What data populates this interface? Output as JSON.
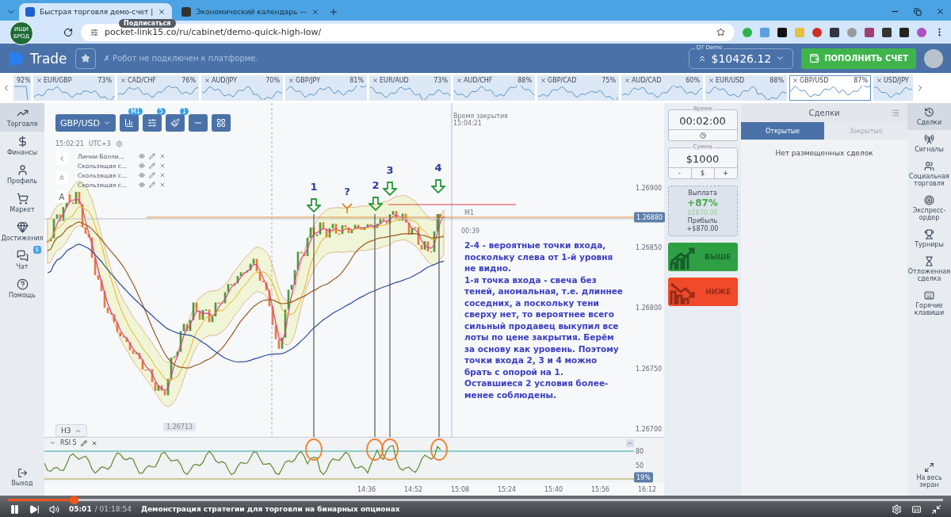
{
  "browser": {
    "tabs": [
      {
        "title": "Быстрая торговля демо-счет |",
        "selected": true
      },
      {
        "title": "Экономический календарь —",
        "selected": false
      }
    ],
    "url": "pocket-link15.co/ru/cabinet/demo-quick-high-low/"
  },
  "channel_overlay": {
    "avatar_text": "ИЩИ БРОД",
    "subscribe_tooltip": "Подписаться"
  },
  "header": {
    "logo": "Trade",
    "robot_status": "✗ Робот не подключен к платформе.",
    "account_label": "QT Demo",
    "balance": "$10426.12",
    "deposit_button": "ПОПОЛНИТЬ СЧЕТ"
  },
  "assets": [
    {
      "percent": "92%",
      "selected": false
    },
    {
      "name": "EUR/GBP",
      "percent": "73%",
      "selected": false
    },
    {
      "name": "CAD/CHF",
      "percent": "76%",
      "selected": false
    },
    {
      "name": "AUD/JPY",
      "percent": "70%",
      "selected": false
    },
    {
      "name": "GBP/JPY",
      "percent": "81%",
      "selected": false
    },
    {
      "name": "EUR/AUD",
      "percent": "73%",
      "selected": false
    },
    {
      "name": "AUD/CHF",
      "percent": "88%",
      "selected": false
    },
    {
      "name": "GBP/CAD",
      "percent": "75%",
      "selected": false
    },
    {
      "name": "AUD/CAD",
      "percent": "60%",
      "selected": false
    },
    {
      "name": "EUR/USD",
      "percent": "88%",
      "selected": false
    },
    {
      "name": "GBP/USD",
      "percent": "87%",
      "selected": true
    },
    {
      "name": "USD/JPY",
      "selected": false
    }
  ],
  "left_sidebar": {
    "items": [
      {
        "label": "Торговля",
        "selected": true
      },
      {
        "label": "Финансы",
        "selected": false
      },
      {
        "label": "Профиль",
        "selected": false
      },
      {
        "label": "Маркет",
        "selected": false
      },
      {
        "label": "Достижения",
        "selected": false
      },
      {
        "label": "Чат",
        "selected": false,
        "badge": "5"
      },
      {
        "label": "Помощь",
        "selected": false
      }
    ],
    "exit": "Выход"
  },
  "chart": {
    "pair": "GBP/USD",
    "toolbar_badges": [
      "M1",
      "5",
      "1"
    ],
    "clock": "15:02:21",
    "timezone": "UTC+3",
    "indicators": [
      "Линии Болли...",
      "Скользящая с...",
      "Скользящая с...",
      "Скользящая с..."
    ],
    "text_tool": "A",
    "closing_time_label": "Время закрытия",
    "closing_time": "15:04:21",
    "price_labels": [
      "1.26900",
      "1.26850",
      "1.26800",
      "1.26750",
      "1.26700"
    ],
    "current_price": "1.26880",
    "timeframe": "M1",
    "countdown": "00:39",
    "min_price": "1.26713",
    "zoom_button": "H3",
    "annotations": [
      {
        "label": "1",
        "kind": "arrow"
      },
      {
        "label": "?",
        "kind": "fork"
      },
      {
        "label": "2",
        "kind": "arrow"
      },
      {
        "label": "3",
        "kind": "arrow"
      },
      {
        "label": "4",
        "kind": "arrow"
      }
    ],
    "note": [
      "2-4 - вероятные точки входа, поскольку слева от 1-й уровня не видно.",
      "1-я точка входа - свеча без теней, аномальная, т.е. длиннее соседних, а поскольку тени сверху нет, то вероятнее всего сильный продавец выкупил все лоты по цене закрытия. Берём за основу как уровень. Поэтому точки входа 2, 3 и 4 можно брать с опорой на 1.",
      "Оставшиеся 2 условия более-менее соблюдены."
    ],
    "rsi": {
      "label": "RSI 5",
      "levels": [
        "80",
        "50"
      ],
      "value": "19%"
    },
    "time_labels": [
      "14:36",
      "14:52",
      "15:08",
      "15:24",
      "15:40",
      "15:56",
      "16:12"
    ]
  },
  "trade_panel": {
    "time_label": "Время",
    "time": "00:02:00",
    "amount_label": "Сумма",
    "amount": "$1000",
    "amount_buttons": [
      "-",
      "$",
      "+"
    ],
    "payout_label": "Выплата",
    "payout_percent": "+87%",
    "payout_total": "$1870.00",
    "profit_label": "Прибыль",
    "profit": "+$870.00",
    "buttons": [
      {
        "label": "ВЫШЕ",
        "kind": "up"
      },
      {
        "label": "НИЖЕ",
        "kind": "down"
      }
    ]
  },
  "deals": {
    "title": "Сделки",
    "tabs": [
      {
        "label": "Открытые",
        "selected": true
      },
      {
        "label": "Закрытые",
        "selected": false
      }
    ],
    "empty": "Нет размещенных сделок"
  },
  "right_sidebar": {
    "items": [
      {
        "label": "Сделки",
        "selected": true
      },
      {
        "label": "Сигналы",
        "selected": false
      },
      {
        "label": "Социальная торговля",
        "selected": false
      },
      {
        "label": "Экспресс-ордер",
        "selected": false
      },
      {
        "label": "Турниры",
        "selected": false
      },
      {
        "label": "Отложенная сделка",
        "selected": false
      },
      {
        "label": "Горячие клавиши",
        "selected": false
      }
    ],
    "fullscreen": "На весь экран"
  },
  "video": {
    "current_time": "05:01",
    "duration": "/ 01:18:54",
    "title": "Демонстрация стратегии для торговли на бинарных опционах",
    "progress": {
      "level": 0.07
    }
  }
}
